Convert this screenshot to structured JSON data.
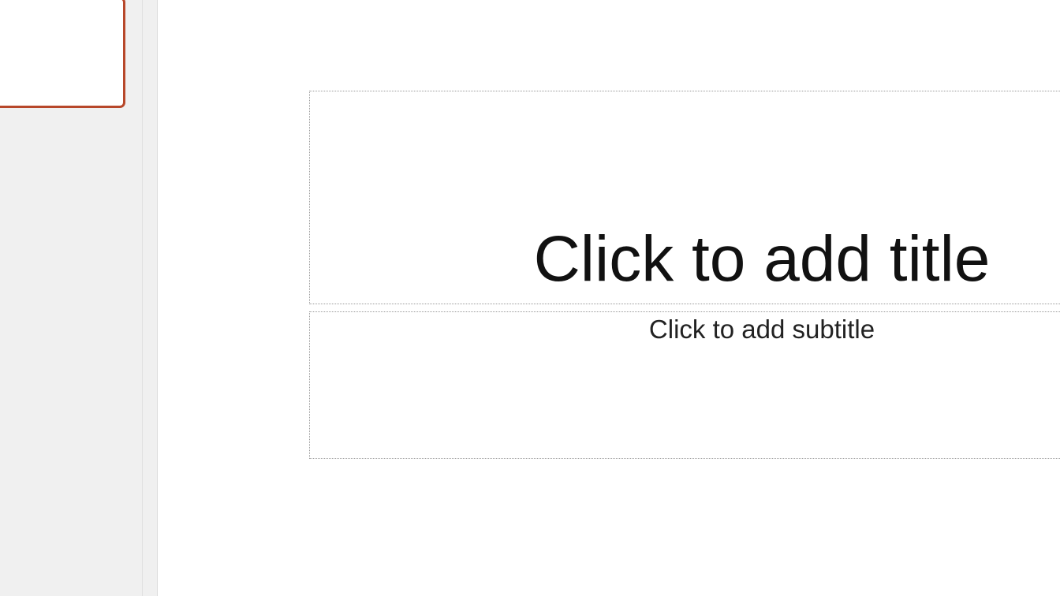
{
  "slide": {
    "title_placeholder": "Click to add title",
    "subtitle_placeholder": "Click to add subtitle"
  },
  "colors": {
    "selected_thumbnail_border": "#b7472a",
    "pane_background": "#f0f0f0"
  }
}
